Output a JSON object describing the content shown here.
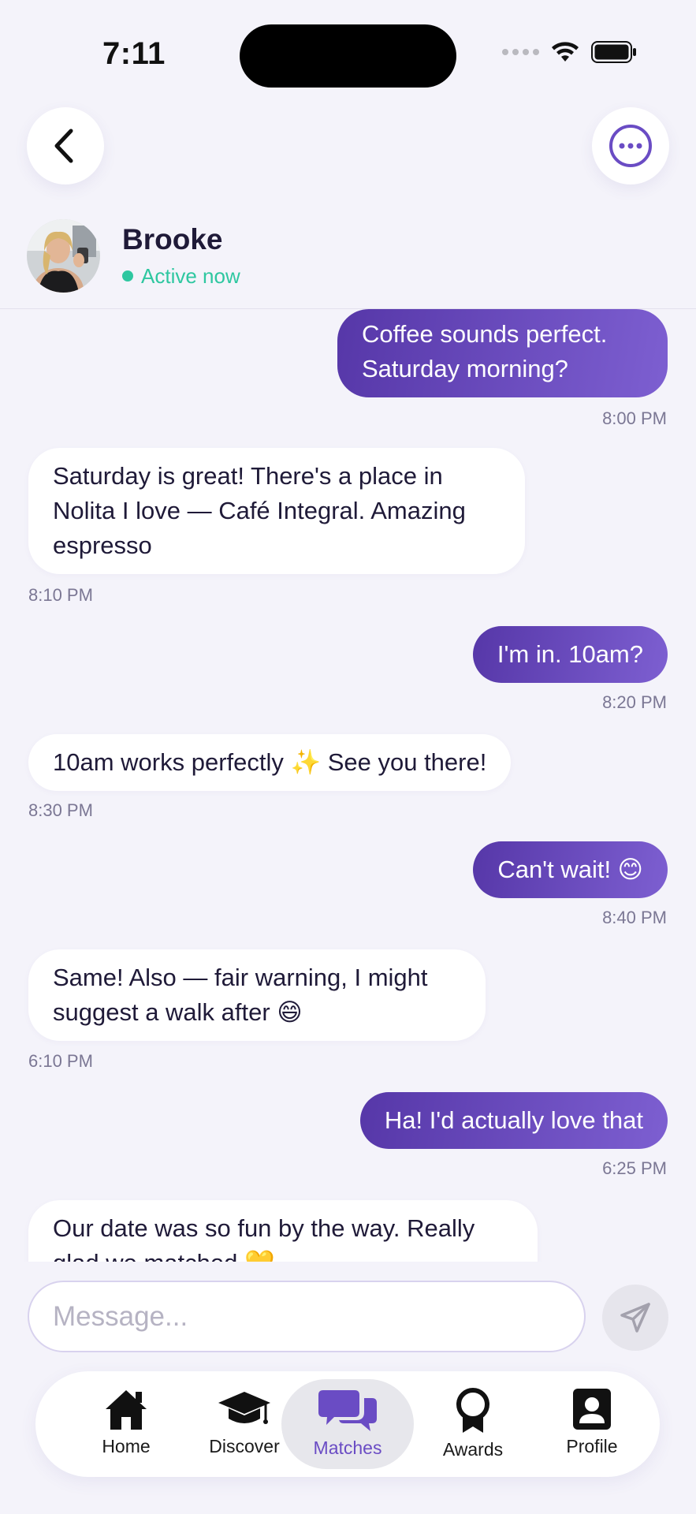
{
  "status_bar": {
    "time": "7:11"
  },
  "header": {
    "contact_name": "Brooke",
    "presence": "Active now"
  },
  "colors": {
    "accent": "#6a4cc4",
    "sent_bubble_start": "#5637a8",
    "sent_bubble_end": "#7d5fd1",
    "presence_green": "#2ec7a0",
    "background": "#f4f3fa"
  },
  "messages": [
    {
      "direction": "sent",
      "text": "Coffee sounds perfect. Saturday morning?",
      "time": "8:00 PM"
    },
    {
      "direction": "received",
      "text": "Saturday is great! There's a place in Nolita I love — Café Integral. Amazing espresso",
      "time": "8:10 PM"
    },
    {
      "direction": "sent",
      "text": "I'm in. 10am?",
      "time": "8:20 PM"
    },
    {
      "direction": "received",
      "text": "10am works perfectly ✨ See you there!",
      "time": "8:30 PM"
    },
    {
      "direction": "sent",
      "text": "Can't wait! 😊",
      "time": "8:40 PM"
    },
    {
      "direction": "received",
      "text": "Same! Also — fair warning, I might suggest a walk after 😄",
      "time": "6:10 PM"
    },
    {
      "direction": "sent",
      "text": "Ha! I'd actually love that",
      "time": "6:25 PM"
    },
    {
      "direction": "received",
      "text": "Our date was so fun by the way. Really glad we matched 💛",
      "time": ""
    }
  ],
  "composer": {
    "placeholder": "Message..."
  },
  "tabs": [
    {
      "label": "Home",
      "icon": "house-icon",
      "active": false
    },
    {
      "label": "Discover",
      "icon": "graduation-cap-icon",
      "active": false
    },
    {
      "label": "Matches",
      "icon": "chat-bubbles-icon",
      "active": true
    },
    {
      "label": "Awards",
      "icon": "award-ribbon-icon",
      "active": false
    },
    {
      "label": "Profile",
      "icon": "person-card-icon",
      "active": false
    }
  ]
}
